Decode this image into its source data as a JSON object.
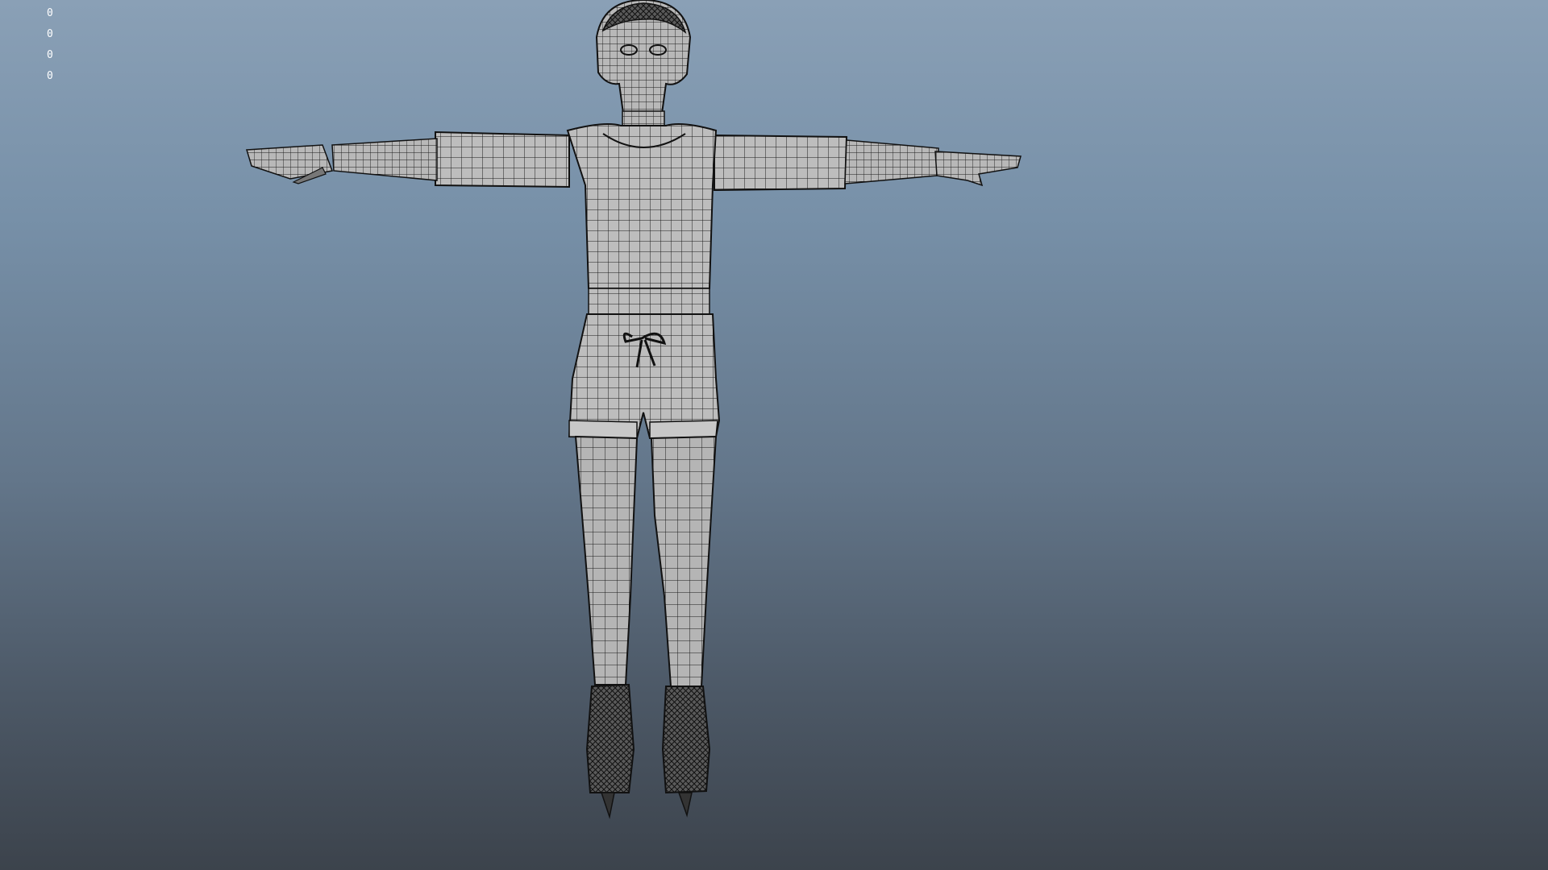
{
  "viewport": {
    "background_top": "#8aa0b6",
    "background_bottom": "#3c434c",
    "hud_values": [
      "0",
      "0",
      "0",
      "0"
    ],
    "wire_color": "#111111",
    "mesh_fill": "#bcbcbc"
  }
}
